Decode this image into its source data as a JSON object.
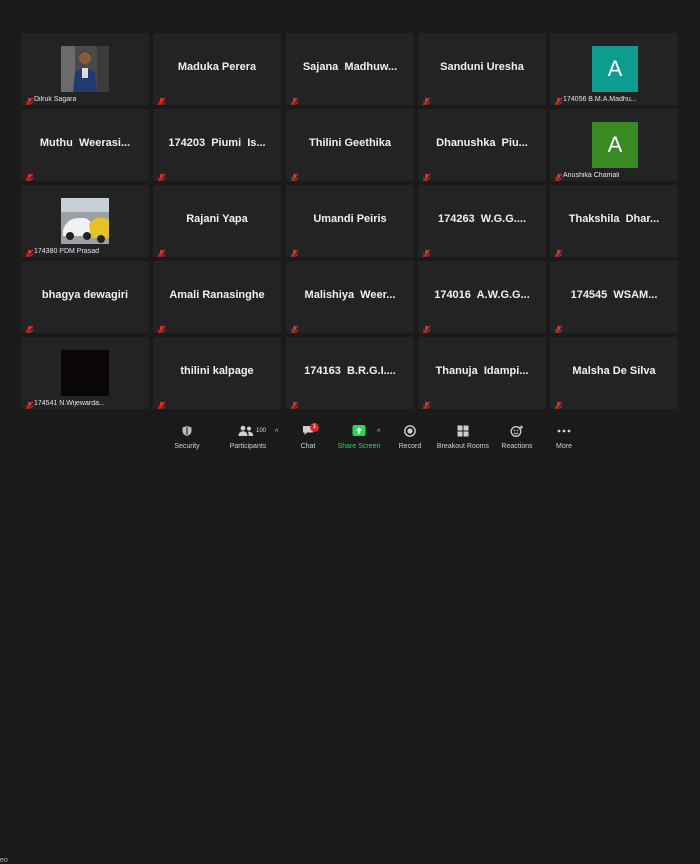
{
  "grid": {
    "rows": [
      [
        {
          "type": "photo",
          "photo": "person",
          "label": "Dilruk Sagara"
        },
        {
          "type": "name",
          "name": "Maduka Perera"
        },
        {
          "type": "name",
          "name": "Sajana  Madhuw..."
        },
        {
          "type": "name",
          "name": "Sanduni Uresha"
        },
        {
          "type": "avatar",
          "initial": "A",
          "color": "#0e9c8f",
          "label": "174056 B.M.A.Madhu..."
        }
      ],
      [
        {
          "type": "name",
          "name": "Muthu  Weerasi..."
        },
        {
          "type": "name",
          "name": "174203  Piumi  Is..."
        },
        {
          "type": "name",
          "name": "Thilini Geethika"
        },
        {
          "type": "name",
          "name": "Dhanushka  Piu..."
        },
        {
          "type": "avatar",
          "initial": "A",
          "color": "#3a8a23",
          "label": "Anushika Chamali"
        }
      ],
      [
        {
          "type": "photo",
          "photo": "cars",
          "label": "174380 PDM Prasad"
        },
        {
          "type": "name",
          "name": "Rajani Yapa"
        },
        {
          "type": "name",
          "name": "Umandi Peiris"
        },
        {
          "type": "name",
          "name": "174263  W.G.G...."
        },
        {
          "type": "name",
          "name": "Thakshila  Dhar..."
        }
      ],
      [
        {
          "type": "name",
          "name": "bhagya dewagiri"
        },
        {
          "type": "name",
          "name": "Amali Ranasinghe"
        },
        {
          "type": "name",
          "name": "Malishiya  Weer..."
        },
        {
          "type": "name",
          "name": "174016  A.W.G.G..."
        },
        {
          "type": "name",
          "name": "174545  WSAM..."
        }
      ],
      [
        {
          "type": "photo",
          "photo": "dark",
          "label": "174541 N.Wijewarda..."
        },
        {
          "type": "name",
          "name": "thilini kalpage"
        },
        {
          "type": "name",
          "name": "174163  B.R.G.I...."
        },
        {
          "type": "name",
          "name": "Thanuja  Idampi..."
        },
        {
          "type": "name",
          "name": "Malsha De Silva"
        }
      ]
    ]
  },
  "toolbar": {
    "security_label": "Security",
    "participants_label": "Participants",
    "participants_count": "100",
    "chat_label": "Chat",
    "chat_badge": "1",
    "share_label": "Share Screen",
    "record_label": "Record",
    "breakout_label": "Breakout Rooms",
    "reactions_label": "Reactions",
    "more_label": "More",
    "edge_text": "eo"
  },
  "colors": {
    "share_green": "#23d959",
    "mic_red": "#e0302a",
    "tile_bg": "#232323"
  },
  "icons": {
    "muted": "mic-muted-icon",
    "security": "shield-icon",
    "participants": "people-icon",
    "chat": "chat-bubble-icon",
    "share": "share-arrow-icon",
    "record": "record-icon",
    "breakout": "grid-icon",
    "reactions": "smile-plus-icon",
    "more": "ellipsis-icon"
  }
}
